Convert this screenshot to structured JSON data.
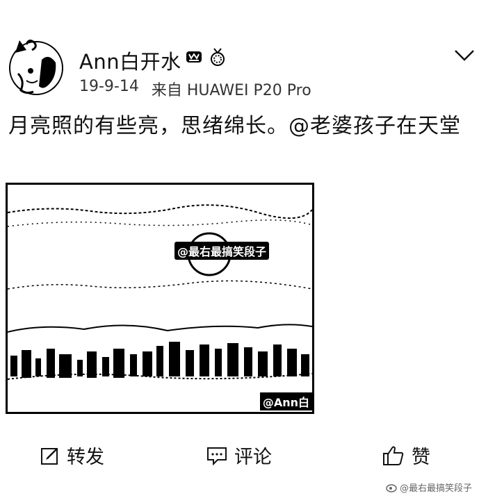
{
  "user": {
    "name": "Ann白开水",
    "badge_icons": [
      "vip-crown-icon",
      "medal-icon"
    ]
  },
  "post": {
    "date": "19-9-14",
    "source": "来自 HUAWEI P20 Pro",
    "text": "月亮照的有些亮，思绪绵长。@老婆孩子在天堂",
    "image_watermark_1": "@最右最搞笑段子",
    "image_watermark_2": "@Ann白"
  },
  "actions": {
    "repost_label": "转发",
    "comment_label": "评论",
    "like_label": "赞"
  },
  "footer": {
    "watermark": "@最右最搞笑段子"
  },
  "icons": {
    "more": "chevron-down-icon",
    "repost": "share-edit-icon",
    "comment": "comment-icon",
    "like": "thumbs-up-icon"
  }
}
